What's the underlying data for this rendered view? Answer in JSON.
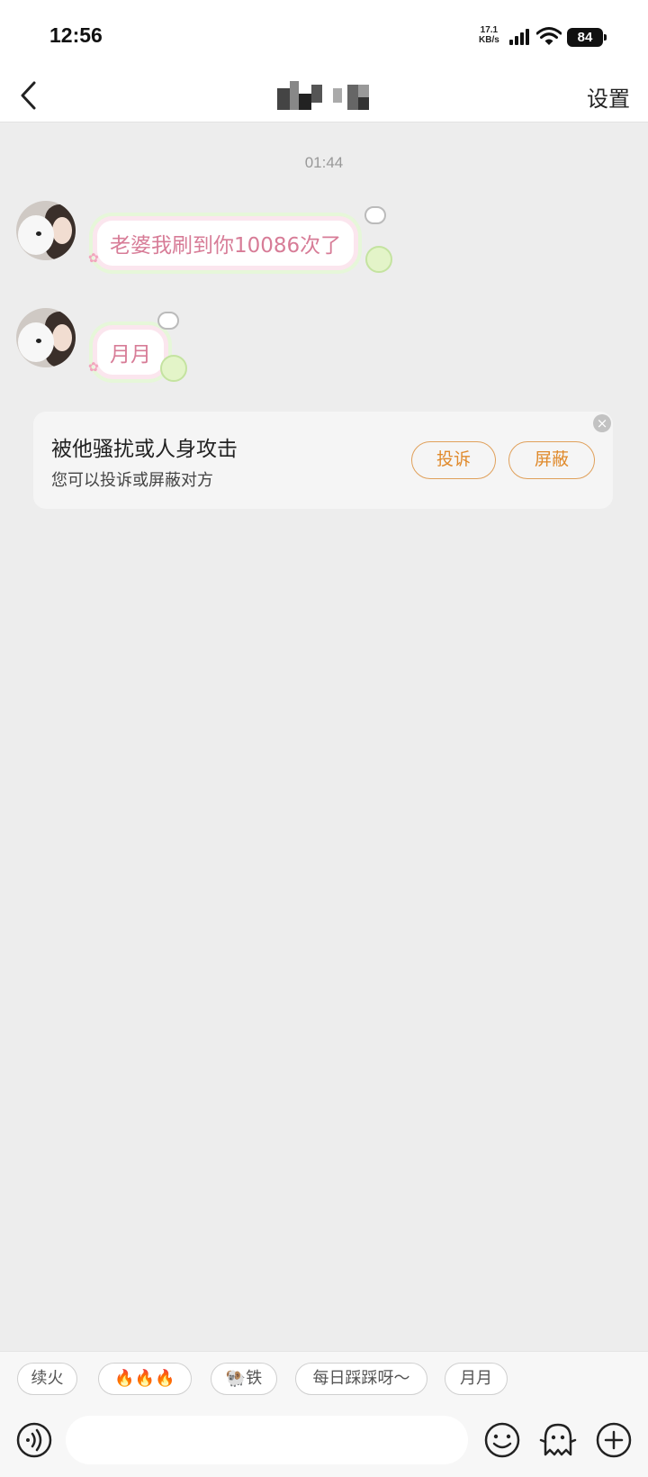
{
  "status_bar": {
    "time": "12:56",
    "net_speed_value": "17.1",
    "net_speed_unit": "KB/s",
    "battery": "84"
  },
  "nav": {
    "settings_label": "设置"
  },
  "chat": {
    "timestamp": "01:44",
    "messages": [
      {
        "text": "老婆我刷到你10086次了"
      },
      {
        "text": "月月"
      }
    ]
  },
  "report_card": {
    "title": "被他骚扰或人身攻击",
    "subtitle": "您可以投诉或屏蔽对方",
    "complain_label": "投诉",
    "block_label": "屏蔽",
    "close_icon": "close-icon"
  },
  "quick_replies": [
    {
      "label": "续火"
    },
    {
      "label": "🔥🔥🔥"
    },
    {
      "label": "🐏铁"
    },
    {
      "label": "每日踩踩呀～"
    },
    {
      "label": "月月"
    }
  ],
  "toolbar": {
    "icons": [
      "voice-icon",
      "emoji-icon",
      "ghost-sticker-icon",
      "plus-icon"
    ]
  },
  "colors": {
    "accent": "#e08a2c",
    "bubble_text": "#d77c97",
    "background": "#ededed"
  }
}
